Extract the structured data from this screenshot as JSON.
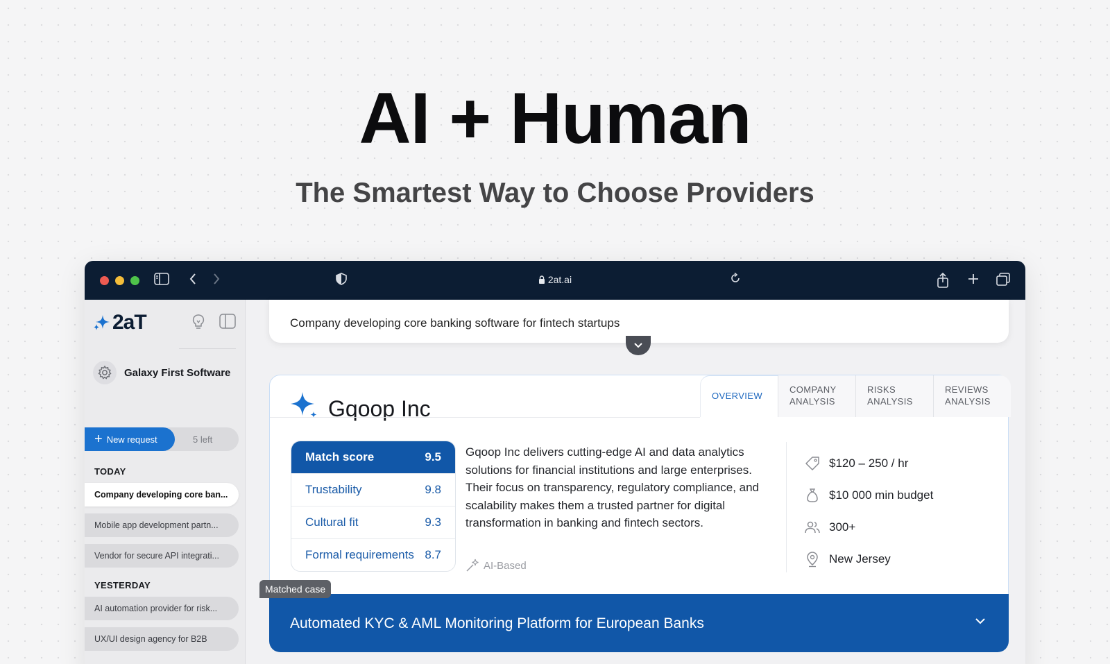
{
  "hero": {
    "title": "AI + Human",
    "subtitle": "The Smartest Way to Choose Providers"
  },
  "browser": {
    "url": "2at.ai",
    "icons": [
      "sidebar-toggle-icon",
      "back-icon",
      "forward-icon",
      "shield-icon",
      "lock-icon",
      "reload-icon",
      "share-icon",
      "new-tab-icon",
      "tabs-overview-icon"
    ]
  },
  "sidebar": {
    "logo_text": "2aT",
    "company_name": "Galaxy First Software",
    "new_request_label": "New request",
    "requests_left": "5 left",
    "sections": [
      {
        "label": "TODAY",
        "items": [
          {
            "label": "Company developing core ban...",
            "active": true
          },
          {
            "label": "Mobile app development partn...",
            "active": false
          },
          {
            "label": "Vendor for secure API integrati...",
            "active": false
          }
        ]
      },
      {
        "label": "YESTERDAY",
        "items": [
          {
            "label": "AI automation provider for risk...",
            "active": false
          },
          {
            "label": "UX/UI design agency for B2B",
            "active": false
          }
        ]
      }
    ]
  },
  "query": {
    "text": "Company developing core banking software for fintech startups"
  },
  "result": {
    "company": "Gqoop Inc",
    "tabs": [
      {
        "line1": "OVERVIEW",
        "line2": "",
        "active": true
      },
      {
        "line1": "COMPANY",
        "line2": "ANALYSIS",
        "active": false
      },
      {
        "line1": "RISKS",
        "line2": "ANALYSIS",
        "active": false
      },
      {
        "line1": "REVIEWS",
        "line2": "ANALYSIS",
        "active": false
      }
    ],
    "scores": {
      "header_label": "Match score",
      "header_value": "9.5",
      "rows": [
        {
          "label": "Trustability",
          "value": "9.8"
        },
        {
          "label": "Cultural fit",
          "value": "9.3"
        },
        {
          "label": "Formal requirements",
          "value": "8.7"
        }
      ]
    },
    "description": "Gqoop Inc delivers cutting-edge AI and data analytics solutions for financial institutions and large enterprises. Their focus on transparency, regulatory compliance, and scalability makes them a trusted partner for digital transformation in banking and fintech sectors.",
    "ai_tag": "AI-Based",
    "facts": {
      "rate": "$120 – 250 / hr",
      "budget": "$10 000 min budget",
      "employees": "300+",
      "location": "New Jersey"
    }
  },
  "matched_case": {
    "badge": "Matched case",
    "title": "Automated KYC & AML Monitoring Platform for European Banks"
  },
  "colors": {
    "brand_blue": "#1157a8",
    "chrome_navy": "#0c1d33",
    "accent_blue": "#1b72cf"
  }
}
